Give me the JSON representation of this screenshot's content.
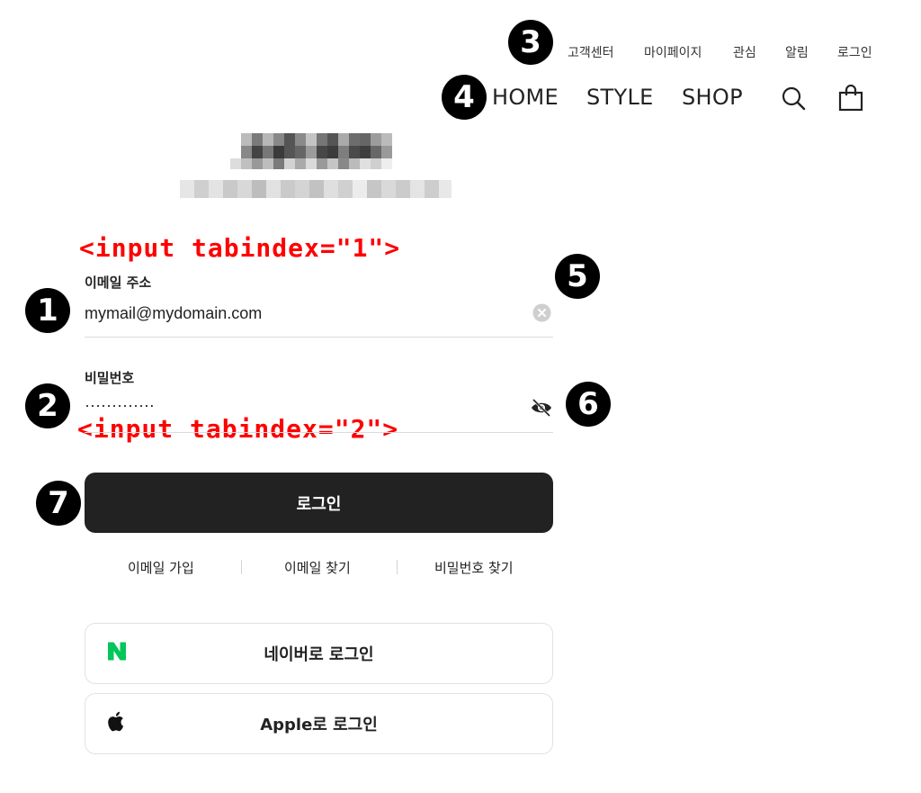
{
  "utility_menu": [
    "고객센터",
    "마이페이지",
    "관심",
    "알림",
    "로그인"
  ],
  "main_nav": [
    "HOME",
    "STYLE",
    "SHOP"
  ],
  "annotations": [
    "1",
    "2",
    "3",
    "4",
    "5",
    "6",
    "7"
  ],
  "code_labels": {
    "email": "<input tabindex=\"1\">",
    "password": "<input tabindex=\"2\">"
  },
  "email_field": {
    "label": "이메일 주소",
    "value": "mymail@mydomain.com"
  },
  "password_field": {
    "label": "비밀번호",
    "value": "·············"
  },
  "login_button": "로그인",
  "helper_links": [
    "이메일 가입",
    "이메일 찾기",
    "비밀번호 찾기"
  ],
  "social_logins": {
    "naver": "네이버로 로그인",
    "apple": "Apple로 로그인"
  },
  "colors": {
    "naver_green": "#03c75a",
    "code_red": "#ff0000",
    "button_dark": "#222222"
  },
  "icons": [
    "search-icon",
    "shopping-bag-icon",
    "clear-icon",
    "eye-off-icon",
    "naver-icon",
    "apple-icon"
  ]
}
